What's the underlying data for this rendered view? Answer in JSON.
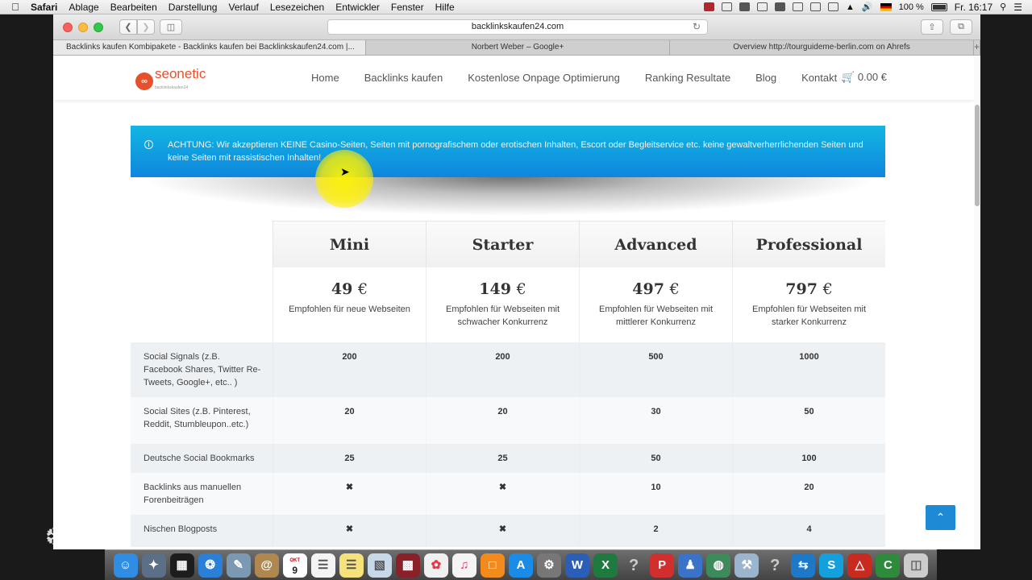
{
  "menubar": {
    "app": "Safari",
    "items": [
      "Ablage",
      "Bearbeiten",
      "Darstellung",
      "Verlauf",
      "Lesezeichen",
      "Entwickler",
      "Fenster",
      "Hilfe"
    ],
    "battery": "100 %",
    "clock": "Fr. 16:17"
  },
  "browser": {
    "url": "backlinkskaufen24.com",
    "tabs": [
      "Backlinks kaufen Kombipakete - Backlinks kaufen bei Backlinkskaufen24.com |...",
      "Norbert Weber – Google+",
      "Overview http://tourguideme-berlin.com on Ahrefs"
    ]
  },
  "site": {
    "logo_text": "seonetic",
    "logo_sub": "backlinkskaufen24",
    "nav": [
      "Home",
      "Backlinks kaufen",
      "Kostenlose Onpage Optimierung",
      "Ranking Resultate",
      "Blog",
      "Kontakt"
    ],
    "cart": "0.00 €",
    "alert": "ACHTUNG: Wir akzeptieren KEINE Casino-Seiten, Seiten mit pornografischem oder erotischen Inhalten, Escort oder Begleitservice etc. keine gewaltverherrlichenden Seiten und keine Seiten mit rassistischen Inhalten!"
  },
  "pricing": {
    "plans": [
      {
        "name": "Mini",
        "price": "49",
        "currency": "€",
        "desc": "Empfohlen für neue Webseiten"
      },
      {
        "name": "Starter",
        "price": "149",
        "currency": "€",
        "desc": "Empfohlen für Webseiten mit schwacher Konkurrenz"
      },
      {
        "name": "Advanced",
        "price": "497",
        "currency": "€",
        "desc": "Empfohlen für Webseiten mit mittlerer Konkurrenz"
      },
      {
        "name": "Professional",
        "price": "797",
        "currency": "€",
        "desc": "Empfohlen für Webseiten mit starker Konkurrenz"
      }
    ],
    "features": [
      {
        "label": "Social Signals (z.B. Facebook Shares, Twitter Re-Tweets, Google+, etc.. )",
        "values": [
          "200",
          "200",
          "500",
          "1000"
        ]
      },
      {
        "label": "Social Sites (z.B. Pinterest, Reddit, Stumbleupon..etc.)",
        "values": [
          "20",
          "20",
          "30",
          "50"
        ]
      },
      {
        "label": "Deutsche Social Bookmarks",
        "values": [
          "25",
          "25",
          "50",
          "100"
        ]
      },
      {
        "label": "Backlinks aus manuellen Forenbeiträgen",
        "values": [
          "✖",
          "✖",
          "10",
          "20"
        ]
      },
      {
        "label": "Nischen Blogposts",
        "values": [
          "✖",
          "✖",
          "2",
          "4"
        ]
      }
    ]
  },
  "dock": {
    "calendar_day": "9",
    "calendar_month": "OKT"
  },
  "icons": {
    "apple": "apple-icon",
    "back_to_top": "chevron-up-icon",
    "cart": "cart-icon"
  },
  "colors": {
    "alert_blue": "#0e86de",
    "brand_orange": "#e6502a",
    "x_mark": "#e0507a"
  }
}
